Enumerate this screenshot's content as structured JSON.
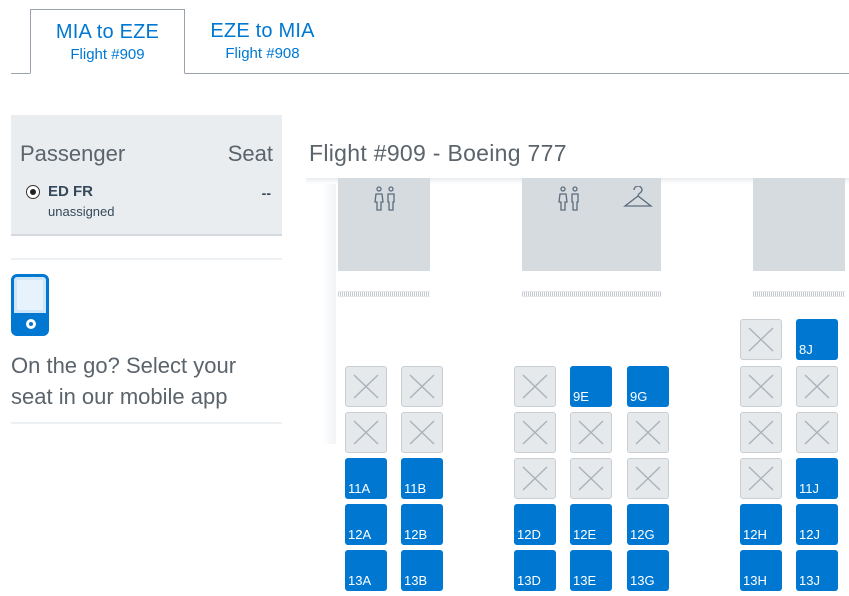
{
  "tabs": [
    {
      "route": "MIA to EZE",
      "flight": "Flight #909",
      "active": true
    },
    {
      "route": "EZE to MIA",
      "flight": "Flight #908",
      "active": false
    }
  ],
  "passenger_panel": {
    "header_passenger": "Passenger",
    "header_seat": "Seat",
    "passenger": {
      "name": "ED FR",
      "status": "unassigned",
      "seat": "--"
    }
  },
  "promo": {
    "text": "On the go? Select your seat in our mobile app"
  },
  "seatmap": {
    "title": "Flight #909 - Boeing 777",
    "rows": [
      {
        "row": "8",
        "seats": {
          "H": "taken",
          "J": "available"
        }
      },
      {
        "row": "9",
        "seats": {
          "A": "taken",
          "B": "taken",
          "D": "taken",
          "E": "available",
          "G": "available",
          "H": "taken",
          "J": "taken"
        }
      },
      {
        "row": "10",
        "seats": {
          "A": "taken",
          "B": "taken",
          "D": "taken",
          "E": "taken",
          "G": "taken",
          "H": "taken",
          "J": "taken"
        }
      },
      {
        "row": "11",
        "seats": {
          "A": "available",
          "B": "available",
          "D": "taken",
          "E": "taken",
          "G": "taken",
          "H": "taken",
          "J": "available"
        }
      },
      {
        "row": "12",
        "seats": {
          "A": "available",
          "B": "available",
          "D": "available",
          "E": "available",
          "G": "available",
          "H": "available",
          "J": "available"
        }
      },
      {
        "row": "13",
        "seats": {
          "A": "available",
          "B": "available",
          "D": "available",
          "E": "available",
          "G": "available",
          "H": "available",
          "J": "available"
        }
      }
    ]
  },
  "colors": {
    "brand": "#0078d2",
    "panel": "#e9edf0",
    "seat_unavailable": "#e6e9ec"
  }
}
